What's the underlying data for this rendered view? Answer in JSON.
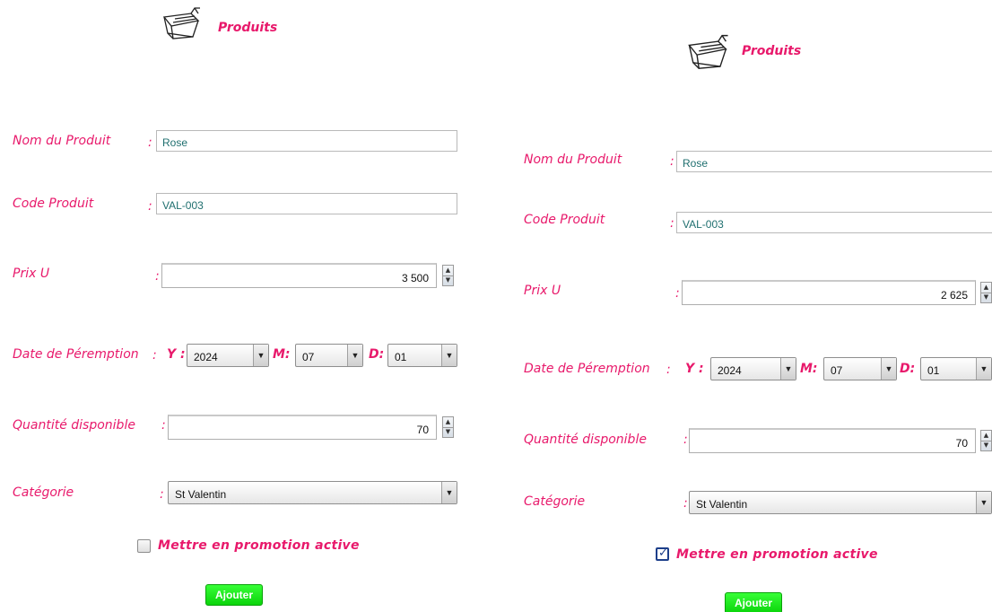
{
  "form_left": {
    "title": "Produits",
    "labels": {
      "nom": "Nom du Produit",
      "code": "Code Produit",
      "prix": "Prix U",
      "date": "Date de Péremption",
      "quantite": "Quantité disponible",
      "categorie": "Catégorie"
    },
    "colon": ":",
    "date_parts": {
      "y": "Y :",
      "m": "M:",
      "d": "D:"
    },
    "values": {
      "nom": "Rose",
      "code": "VAL-003",
      "prix": "3 500",
      "year": "2024",
      "month": "07",
      "day": "01",
      "quantite": "70",
      "categorie": "St Valentin"
    },
    "promo_label": "Mettre en promotion active",
    "promo_checked": false,
    "submit_label": "Ajouter"
  },
  "form_right": {
    "title": "Produits",
    "labels": {
      "nom": "Nom du Produit",
      "code": "Code Produit",
      "prix": "Prix U",
      "date": "Date de Péremption",
      "quantite": "Quantité disponible",
      "categorie": "Catégorie"
    },
    "colon": ":",
    "date_parts": {
      "y": "Y :",
      "m": "M:",
      "d": "D:"
    },
    "values": {
      "nom": "Rose",
      "code": "VAL-003",
      "prix": "2 625",
      "year": "2024",
      "month": "07",
      "day": "01",
      "quantite": "70",
      "categorie": "St Valentin"
    },
    "promo_label": "Mettre en promotion active",
    "promo_checked": true,
    "submit_label": "Ajouter"
  },
  "icons": {
    "cart": "shopping-cart-icon",
    "spin_up": "▲",
    "spin_down": "▼",
    "dropdown": "▼",
    "check": "✓"
  },
  "colors": {
    "label_pink": "#e8196b",
    "button_green": "#1bea1b",
    "input_text": "#1f6f6f"
  }
}
